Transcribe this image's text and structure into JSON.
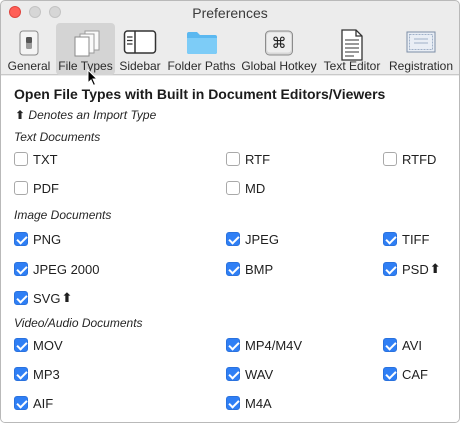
{
  "window": {
    "title": "Preferences",
    "traffic_lights": [
      "close",
      "minimize",
      "zoom"
    ]
  },
  "toolbar": {
    "items": [
      {
        "label": "General",
        "icon": "general-switch-icon",
        "selected": false
      },
      {
        "label": "File Types",
        "icon": "documents-icon",
        "selected": true
      },
      {
        "label": "Sidebar",
        "icon": "sidebar-icon",
        "selected": false
      },
      {
        "label": "Folder Paths",
        "icon": "folder-icon",
        "selected": false
      },
      {
        "label": "Global Hotkey",
        "icon": "command-key-icon",
        "selected": false
      },
      {
        "label": "Text Editor",
        "icon": "text-document-icon",
        "selected": false
      },
      {
        "label": "Registration",
        "icon": "certificate-icon",
        "selected": false
      }
    ]
  },
  "content": {
    "heading": "Open File Types with Built in Document Editors/Viewers",
    "import_note_arrow": "⬆",
    "import_note": "Denotes an Import Type",
    "sections": {
      "text": {
        "label": "Text Documents",
        "items": [
          {
            "label": "TXT",
            "checked": false,
            "import": false
          },
          {
            "label": "RTF",
            "checked": false,
            "import": false
          },
          {
            "label": "RTFD",
            "checked": false,
            "import": false
          },
          {
            "label": "PDF",
            "checked": false,
            "import": false
          },
          {
            "label": "MD",
            "checked": false,
            "import": false
          }
        ]
      },
      "image": {
        "label": "Image Documents",
        "items": [
          {
            "label": "PNG",
            "checked": true,
            "import": false
          },
          {
            "label": "JPEG",
            "checked": true,
            "import": false
          },
          {
            "label": "TIFF",
            "checked": true,
            "import": false
          },
          {
            "label": "JPEG 2000",
            "checked": true,
            "import": false
          },
          {
            "label": "BMP",
            "checked": true,
            "import": false
          },
          {
            "label": "PSD",
            "checked": true,
            "import": true
          },
          {
            "label": "SVG",
            "checked": true,
            "import": true
          }
        ]
      },
      "media": {
        "label": "Video/Audio Documents",
        "items": [
          {
            "label": "MOV",
            "checked": true,
            "import": false
          },
          {
            "label": "MP4/M4V",
            "checked": true,
            "import": false
          },
          {
            "label": "AVI",
            "checked": true,
            "import": false
          },
          {
            "label": "MP3",
            "checked": true,
            "import": false
          },
          {
            "label": "WAV",
            "checked": true,
            "import": false
          },
          {
            "label": "CAF",
            "checked": true,
            "import": false
          },
          {
            "label": "AIF",
            "checked": true,
            "import": false
          },
          {
            "label": "M4A",
            "checked": true,
            "import": false
          }
        ]
      }
    }
  },
  "colors": {
    "accent": "#2f7ff5",
    "close_button": "#ff5f57",
    "folder_icon": "#5bb8f0"
  }
}
